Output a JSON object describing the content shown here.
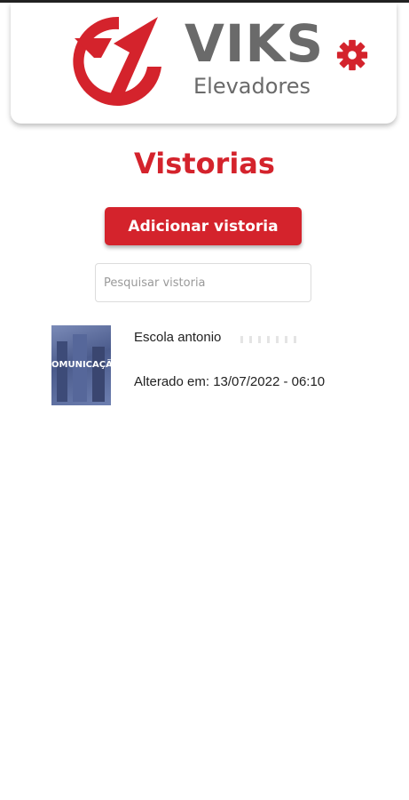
{
  "header": {
    "brand_name": "VIKS",
    "brand_sub": "Elevadores",
    "logo_icon": "viks-logo-mark",
    "settings_icon": "gear-icon",
    "accent_color": "#d4232c",
    "text_color": "#6a6a6a"
  },
  "page": {
    "title": "Vistorias",
    "add_button_label": "Adicionar vistoria",
    "search_placeholder": "Pesquisar vistoria",
    "search_value": ""
  },
  "inspections": [
    {
      "title": "Escola antonio",
      "modified": "Alterado em: 13/07/2022 - 06:10",
      "thumbnail_text": "OMUNICAÇÃ"
    }
  ]
}
